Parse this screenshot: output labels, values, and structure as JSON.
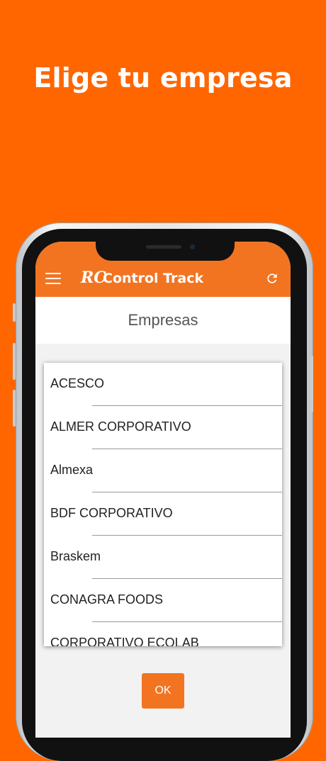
{
  "promo": {
    "headline": "Elige tu empresa"
  },
  "appbar": {
    "logo_mark": "RC",
    "title": "Control Track",
    "menu_icon": "hamburger-menu-icon",
    "refresh_icon": "refresh-icon"
  },
  "section": {
    "title": "Empresas"
  },
  "companies": [
    "ACESCO",
    "ALMER CORPORATIVO",
    "Almexa",
    "BDF CORPORATIVO",
    "Braskem",
    "CONAGRA FOODS",
    "CORPORATIVO ECOLAB"
  ],
  "actions": {
    "ok_label": "OK"
  },
  "colors": {
    "background": "#FF6600",
    "accent": "#F27421"
  }
}
